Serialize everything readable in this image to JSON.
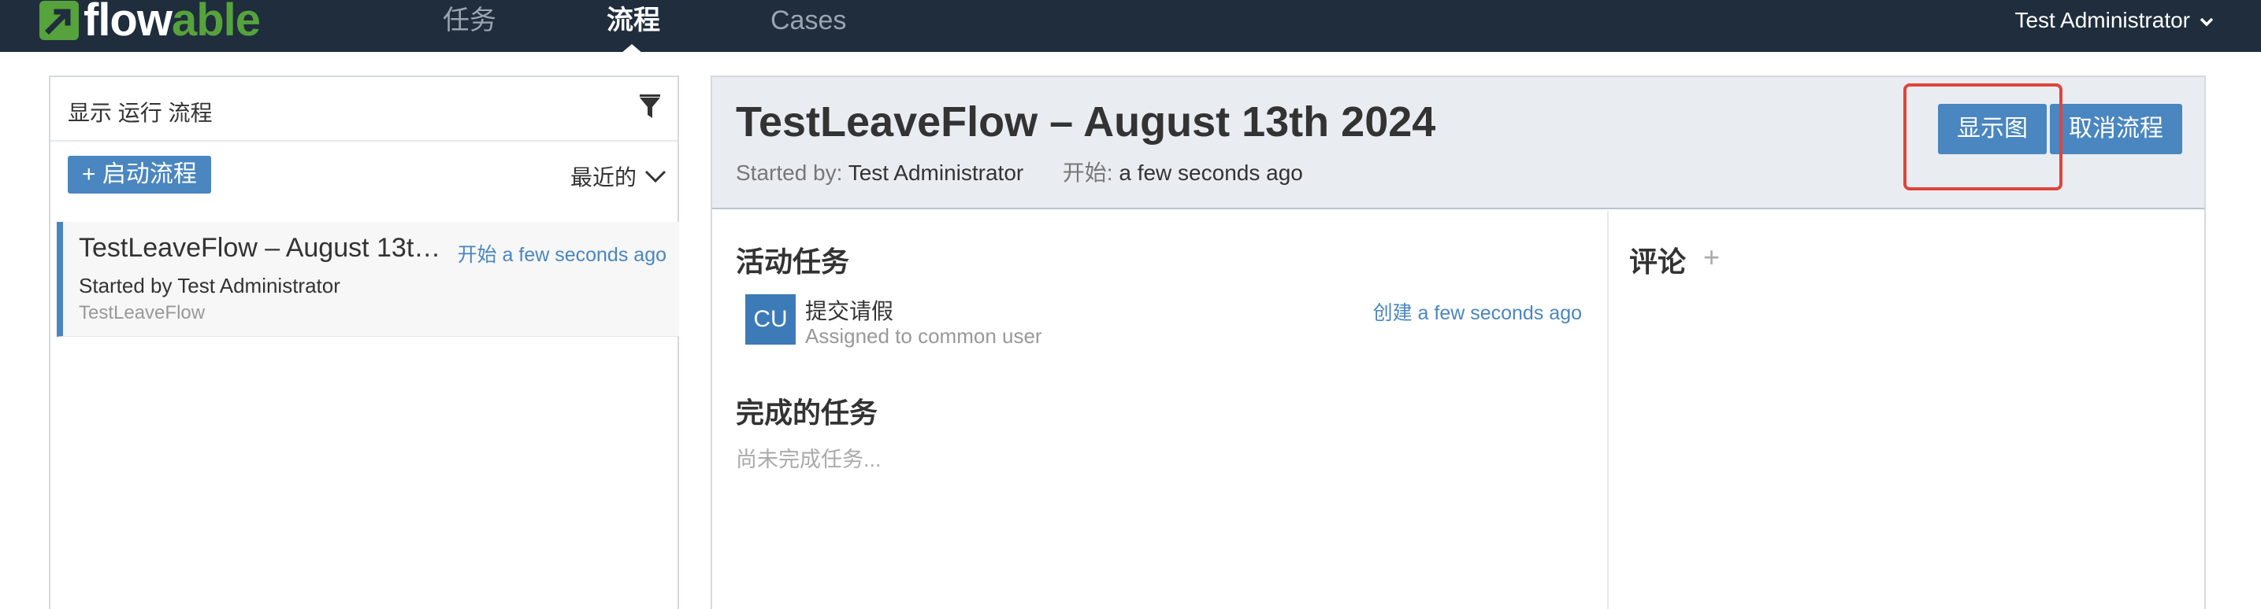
{
  "nav": {
    "logo_text_main": "flow",
    "logo_text_accent": "able",
    "items": [
      "任务",
      "流程",
      "Cases"
    ],
    "active_index": 1,
    "user": "Test Administrator"
  },
  "left": {
    "title": "显示 运行 流程",
    "start_button": "+ 启动流程",
    "sort_label": "最近的",
    "process": {
      "name": "TestLeaveFlow – August 13th 2024",
      "time": "开始 a few seconds ago",
      "started_by": "Started by Test Administrator",
      "definition": "TestLeaveFlow"
    }
  },
  "detail": {
    "title": "TestLeaveFlow – August 13th 2024",
    "started_by_label": "Started by:",
    "started_by": "Test Administrator",
    "start_label": "开始:",
    "start_value": "a few seconds ago",
    "show_diagram_button": "显示图",
    "cancel_button": "取消流程",
    "active_tasks_title": "活动任务",
    "task": {
      "initials": "CU",
      "name": "提交请假",
      "assigned": "Assigned to common user",
      "created": "创建 a few seconds ago"
    },
    "completed_title": "完成的任务",
    "completed_empty": "尚未完成任务...",
    "comments_title": "评论",
    "add_comment": "+"
  },
  "colors": {
    "navbar": "#1f2d3d",
    "brand_green": "#56a23c",
    "primary_blue": "#4a86bf",
    "highlight_red": "#e0443a"
  }
}
